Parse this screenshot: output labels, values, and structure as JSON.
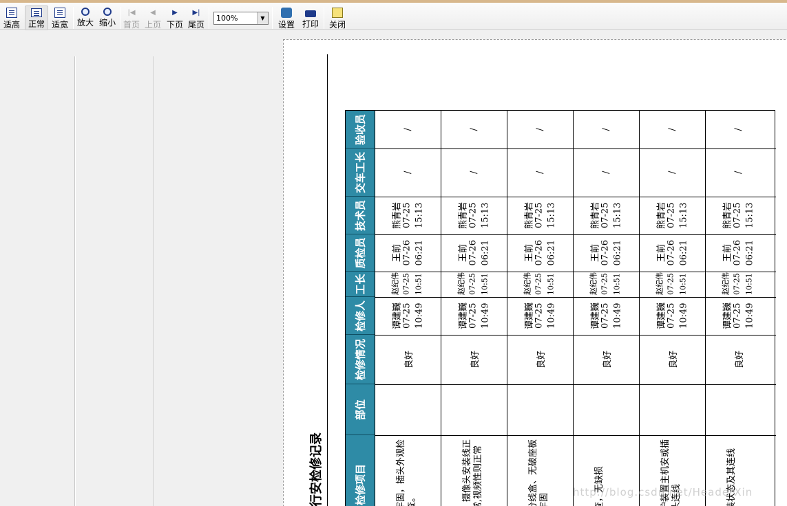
{
  "toolbar": {
    "buttons": [
      {
        "label": "适高",
        "icon": "fit-height-icon"
      },
      {
        "label": "正常",
        "icon": "normal-view-icon"
      },
      {
        "label": "适宽",
        "icon": "fit-width-icon"
      },
      {
        "label": "放大",
        "icon": "zoom-in-icon"
      },
      {
        "label": "缩小",
        "icon": "zoom-out-icon"
      },
      {
        "label": "首页",
        "icon": "first-page-icon"
      },
      {
        "label": "上页",
        "icon": "previous-page-icon"
      },
      {
        "label": "下页",
        "icon": "next-page-icon"
      },
      {
        "label": "尾页",
        "icon": "last-page-icon"
      },
      {
        "label": "设置",
        "icon": "settings-icon"
      },
      {
        "label": "打印",
        "icon": "print-icon"
      },
      {
        "label": "关闭",
        "icon": "close-icon"
      }
    ],
    "zoom_value": "100%"
  },
  "document": {
    "title": "行安检修记录",
    "headers": [
      "检修项目",
      "部位",
      "检修情况",
      "检修人",
      "工长",
      "质检员",
      "技术员",
      "交车工长",
      "验收员"
    ],
    "rows": [
      {
        "item": "牢固，插头外观检查。",
        "part": "",
        "status": "良好",
        "repairer": "谭建巍 07-25 10:49",
        "foreman": "赵纪伟 07-25 10:51",
        "inspector": "王前 07-26 06:21",
        "technician": "熊青岩 07-25 15:13",
        "handover": "/",
        "acceptor": "/"
      },
      {
        "item": "、摄像头安装线正常,视频性则正常",
        "part": "",
        "status": "良好",
        "repairer": "谭建巍 07-25 10:49",
        "foreman": "赵纪伟 07-25 10:51",
        "inspector": "王前 07-26 06:21",
        "technician": "熊青岩 07-25 15:13",
        "handover": "/",
        "acceptor": "/"
      },
      {
        "item": "分线盒、无破座板牢固",
        "part": "",
        "status": "良好",
        "repairer": "谭建巍 07-25 10:49",
        "foreman": "赵纪伟 07-25 10:51",
        "inspector": "王前 07-26 06:21",
        "technician": "熊青岩 07-25 15:13",
        "handover": "/",
        "acceptor": "/"
      },
      {
        "item": "查，无缺损",
        "part": "",
        "status": "良好",
        "repairer": "谭建巍 07-25 10:49",
        "foreman": "赵纪伟 07-25 10:51",
        "inspector": "王前 07-26 06:21",
        "technician": "熊青岩 07-25 15:13",
        "handover": "/",
        "acceptor": "/"
      },
      {
        "item": "护装置主机安或插头连线",
        "part": "",
        "status": "良好",
        "repairer": "谭建巍 07-25 10:49",
        "foreman": "赵纪伟 07-25 10:51",
        "inspector": "王前 07-26 06:21",
        "technician": "熊青岩 07-25 15:13",
        "handover": "/",
        "acceptor": "/"
      },
      {
        "item": "装状态及其连线",
        "part": "",
        "status": "良好",
        "repairer": "谭建巍 07-25 10:49",
        "foreman": "赵纪伟 07-25 10:51",
        "inspector": "王前 07-26 06:21",
        "technician": "熊青岩 07-25 15:13",
        "handover": "/",
        "acceptor": "/"
      }
    ]
  },
  "watermark": "http://blog.csdn.net/HeaderXin"
}
